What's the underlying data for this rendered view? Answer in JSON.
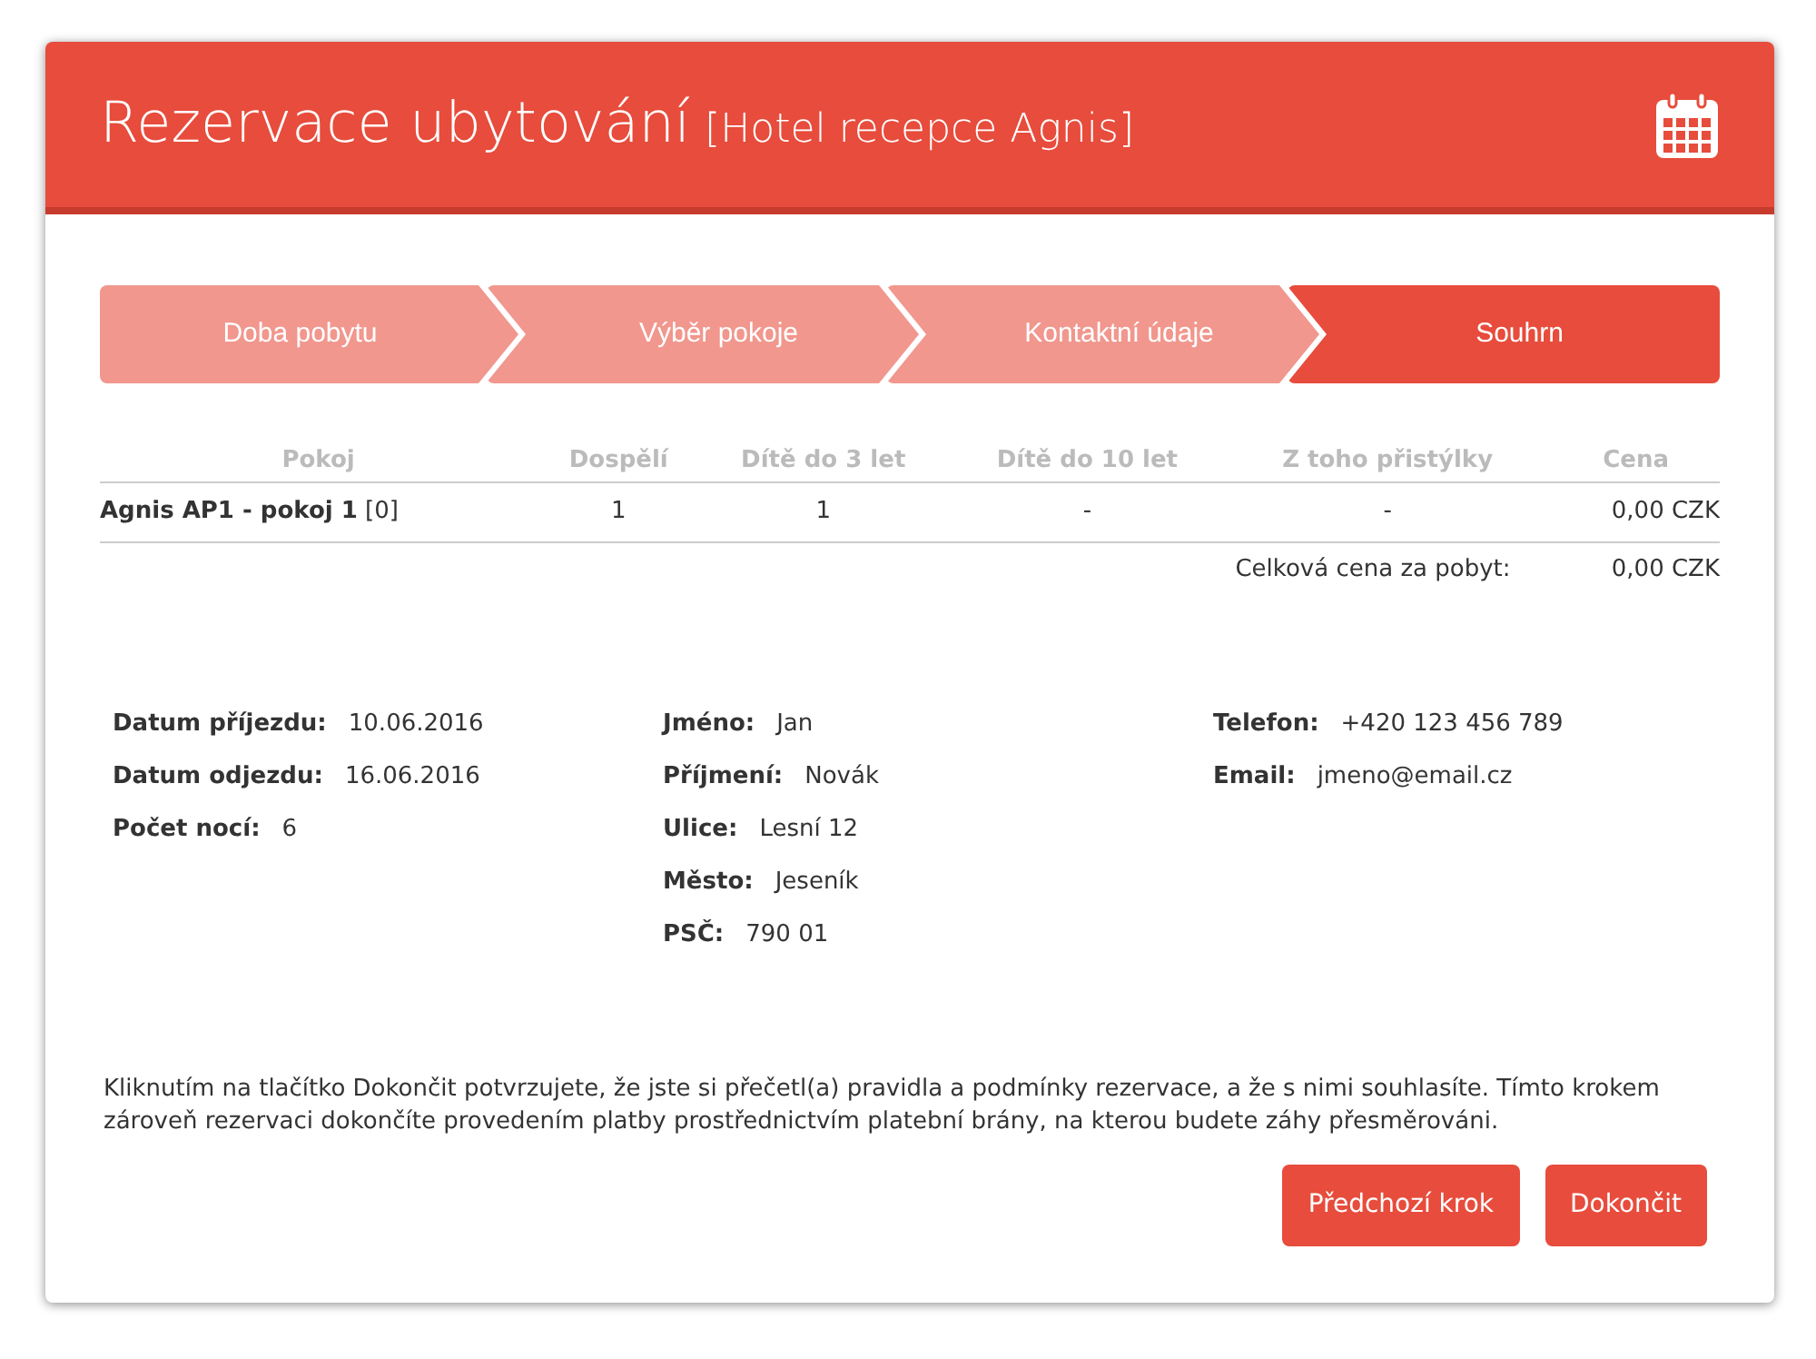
{
  "header": {
    "title": "Rezervace ubytování",
    "subtitle": "[Hotel recepce Agnis]"
  },
  "steps": [
    {
      "label": "Doba pobytu",
      "selected": false
    },
    {
      "label": "Výběr pokoje",
      "selected": false
    },
    {
      "label": "Kontaktní údaje",
      "selected": false
    },
    {
      "label": "Souhrn",
      "selected": true
    }
  ],
  "table": {
    "columns": [
      "Pokoj",
      "Dospělí",
      "Dítě do 3 let",
      "Dítě do 10 let",
      "Z toho přistýlky",
      "Cena"
    ],
    "rows": [
      {
        "cells": [
          "**Agnis AP1 - pokoj 1** [0]",
          "1",
          "1",
          "-",
          "-",
          "0,00 CZK"
        ]
      }
    ],
    "total_label": "Celková cena za pobyt:",
    "total_value": "0,00 CZK"
  },
  "details": [
    [
      {
        "label": "Datum příjezdu:",
        "value": "10.06.2016"
      },
      {
        "label": "Datum odjezdu:",
        "value": "16.06.2016"
      },
      {
        "label": "Počet nocí:",
        "value": "6"
      }
    ],
    [
      {
        "label": "Jméno:",
        "value": "Jan"
      },
      {
        "label": "Příjmení:",
        "value": "Novák"
      },
      {
        "label": "Ulice:",
        "value": "Lesní 12"
      },
      {
        "label": "Město:",
        "value": "Jeseník"
      },
      {
        "label": "PSČ:",
        "value": "790 01"
      }
    ],
    [
      {
        "label": "Telefon:",
        "value": "+420 123 456 789"
      },
      {
        "label": "Email:",
        "value": "jmeno@email.cz"
      }
    ]
  ],
  "notice": "Kliknutím na tlačítko Dokončit potvrzujete, že jste si přečetl(a) pravidla a podmínky rezervace, a že s nimi souhlasíte. Tímto krokem zároveň rezervaci dokončíte provedením platby prostřednictvím platební brány, na kterou budete záhy přesměrováni.",
  "buttons": [
    "Předchozí krok",
    "Dokončit"
  ]
}
